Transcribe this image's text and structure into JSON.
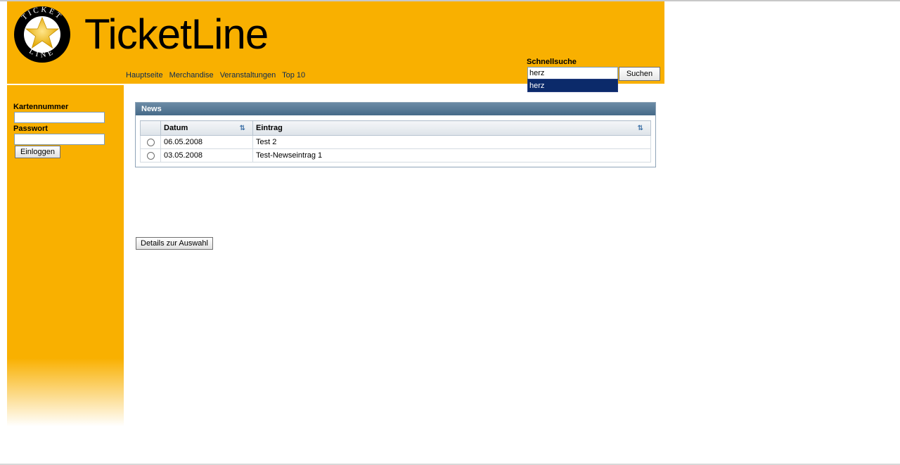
{
  "header": {
    "site_title": "TicketLine",
    "logo": {
      "top_text": "TICKET",
      "bottom_text": "LINE",
      "icon": "star-icon"
    },
    "nav": [
      {
        "label": "Hauptseite"
      },
      {
        "label": "Merchandise"
      },
      {
        "label": "Veranstaltungen"
      },
      {
        "label": "Top 10"
      }
    ],
    "quick_search": {
      "label": "Schnellsuche",
      "value": "herz",
      "button_label": "Suchen",
      "suggestion": "herz"
    }
  },
  "sidebar": {
    "card_label": "Kartennummer",
    "card_value": "",
    "password_label": "Passwort",
    "password_value": "",
    "login_button": "Einloggen"
  },
  "news": {
    "title": "News",
    "columns": {
      "date": "Datum",
      "entry": "Eintrag"
    },
    "rows": [
      {
        "date": "06.05.2008",
        "entry": "Test 2"
      },
      {
        "date": "03.05.2008",
        "entry": "Test-Newseintrag 1"
      }
    ]
  },
  "details_button": "Details zur Auswahl",
  "colors": {
    "brand_orange": "#f9b000",
    "panel_header": "#466a88",
    "dropdown_highlight": "#0b2a6a"
  }
}
